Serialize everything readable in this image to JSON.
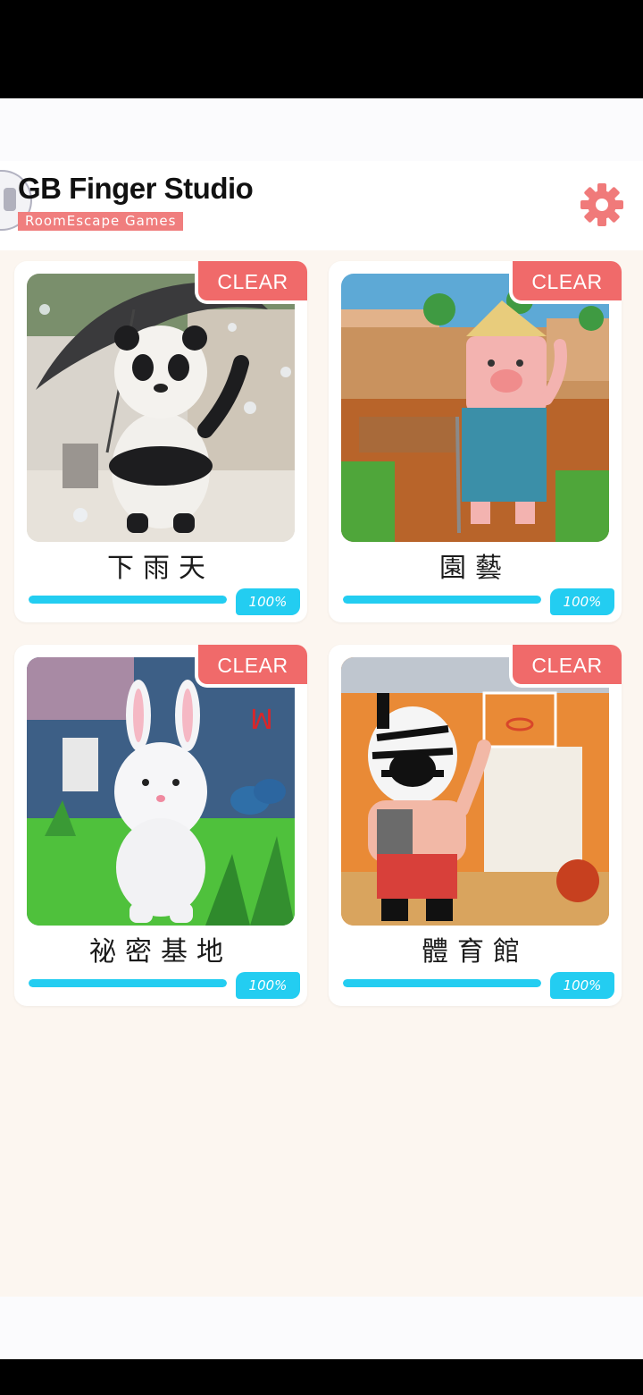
{
  "header": {
    "title": "GB Finger Studio",
    "subtitle": "RoomEscape Games",
    "settings_icon": "gear-icon",
    "accent_color": "#f07e7e"
  },
  "stages": [
    {
      "title": "下雨天",
      "badge": "CLEAR",
      "progress_label": "100%",
      "progress": 1.0,
      "scene": "panda-with-umbrella-in-rain"
    },
    {
      "title": "園藝",
      "badge": "CLEAR",
      "progress_label": "100%",
      "progress": 1.0,
      "scene": "pig-farmer-in-garden"
    },
    {
      "title": "祕密基地",
      "badge": "CLEAR",
      "progress_label": "100%",
      "progress": 1.0,
      "scene": "rabbit-in-backyard"
    },
    {
      "title": "體育館",
      "badge": "CLEAR",
      "progress_label": "100%",
      "progress": 1.0,
      "scene": "zebra-coach-in-gym"
    }
  ],
  "colors": {
    "badge": "#f06a6a",
    "progress": "#23cdf1",
    "background": "#fcf6f0"
  }
}
